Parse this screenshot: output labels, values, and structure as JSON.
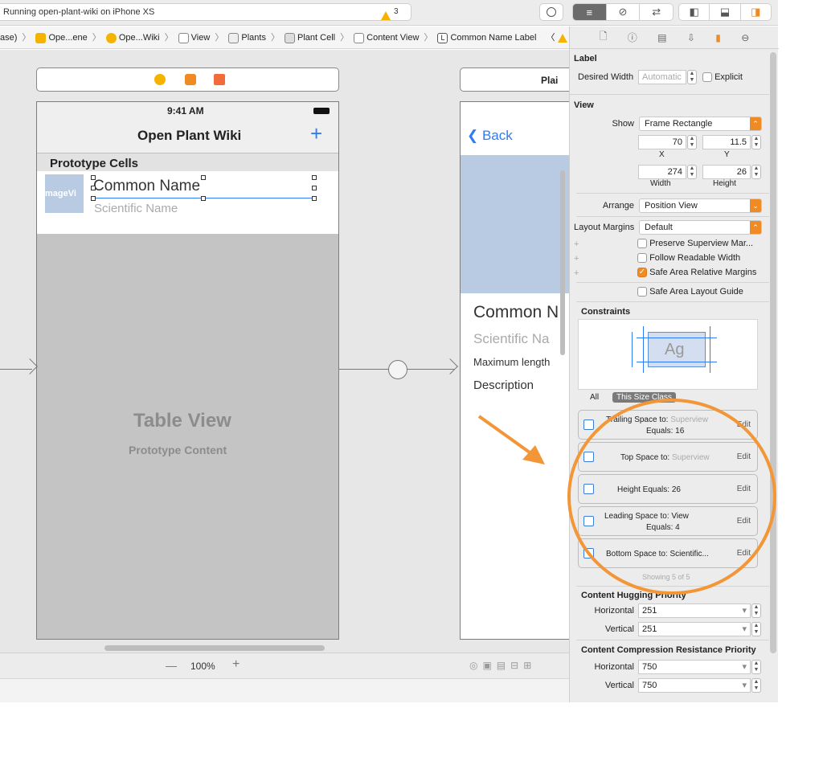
{
  "toolbar": {
    "status": "Running open-plant-wiki on iPhone XS",
    "warning_count": "3"
  },
  "jumpbar": {
    "items": [
      "ase)",
      "Ope...ene",
      "Ope...Wiki",
      "View",
      "Plants",
      "Plant Cell",
      "Content View",
      "Common Name Label"
    ]
  },
  "canvas": {
    "phone1": {
      "time": "9:41 AM",
      "title": "Open Plant Wiki",
      "add": "+",
      "section": "Prototype Cells",
      "image_label": "mageVi",
      "common_name": "Common Name",
      "scientific_name": "Scientific Name",
      "table_view": "Table View",
      "prototype_content": "Prototype Content"
    },
    "phone2": {
      "scene_title": "Plai",
      "back": "Back",
      "common_name": "Common N",
      "scientific_name": "Scientific Na",
      "max_length": "Maximum length",
      "description": "Description"
    },
    "zoom": "100%",
    "zoom_out": "—",
    "zoom_in": "+"
  },
  "inspector": {
    "label_section": "Label",
    "desired_width_label": "Desired Width",
    "desired_width_value": "Automatic",
    "explicit": "Explicit",
    "view_section": "View",
    "show_label": "Show",
    "show_value": "Frame Rectangle",
    "x_value": "70",
    "y_value": "11.5",
    "x_label": "X",
    "y_label": "Y",
    "width_value": "274",
    "height_value": "26",
    "width_label": "Width",
    "height_label": "Height",
    "arrange_label": "Arrange",
    "arrange_value": "Position View",
    "layout_margins_label": "Layout Margins",
    "layout_margins_value": "Default",
    "preserve": "Preserve Superview Mar...",
    "follow": "Follow Readable Width",
    "safe_area_rel": "Safe Area Relative Margins",
    "safe_area_guide": "Safe Area Layout Guide",
    "constraints_section": "Constraints",
    "ag": "Ag",
    "tab_all": "All",
    "tab_size_class": "This Size Class",
    "constraints": [
      {
        "line1": "Trailing Space to:",
        "line1_dim": "Superview",
        "line2": "Equals:  16",
        "edit": "Edit"
      },
      {
        "line1": "Top Space to:",
        "line1_dim": "Superview",
        "line2": "",
        "edit": "Edit"
      },
      {
        "line1": "Height Equals:  26",
        "line1_dim": "",
        "line2": "",
        "edit": "Edit"
      },
      {
        "line1": "Leading Space to:  View",
        "line1_dim": "",
        "line2": "Equals:  4",
        "edit": "Edit"
      },
      {
        "line1": "Bottom Space to:  Scientific...",
        "line1_dim": "",
        "line2": "",
        "edit": "Edit"
      }
    ],
    "showing": "Showing 5 of 5",
    "hugging_section": "Content Hugging Priority",
    "horizontal_label": "Horizontal",
    "vertical_label": "Vertical",
    "hug_h": "251",
    "hug_v": "251",
    "compression_section": "Content Compression Resistance Priority",
    "comp_h": "750",
    "comp_v": "750"
  },
  "colors": {
    "accent": "#f08a24",
    "ios_blue": "#2f7bf6",
    "highlight": "#f29637"
  }
}
